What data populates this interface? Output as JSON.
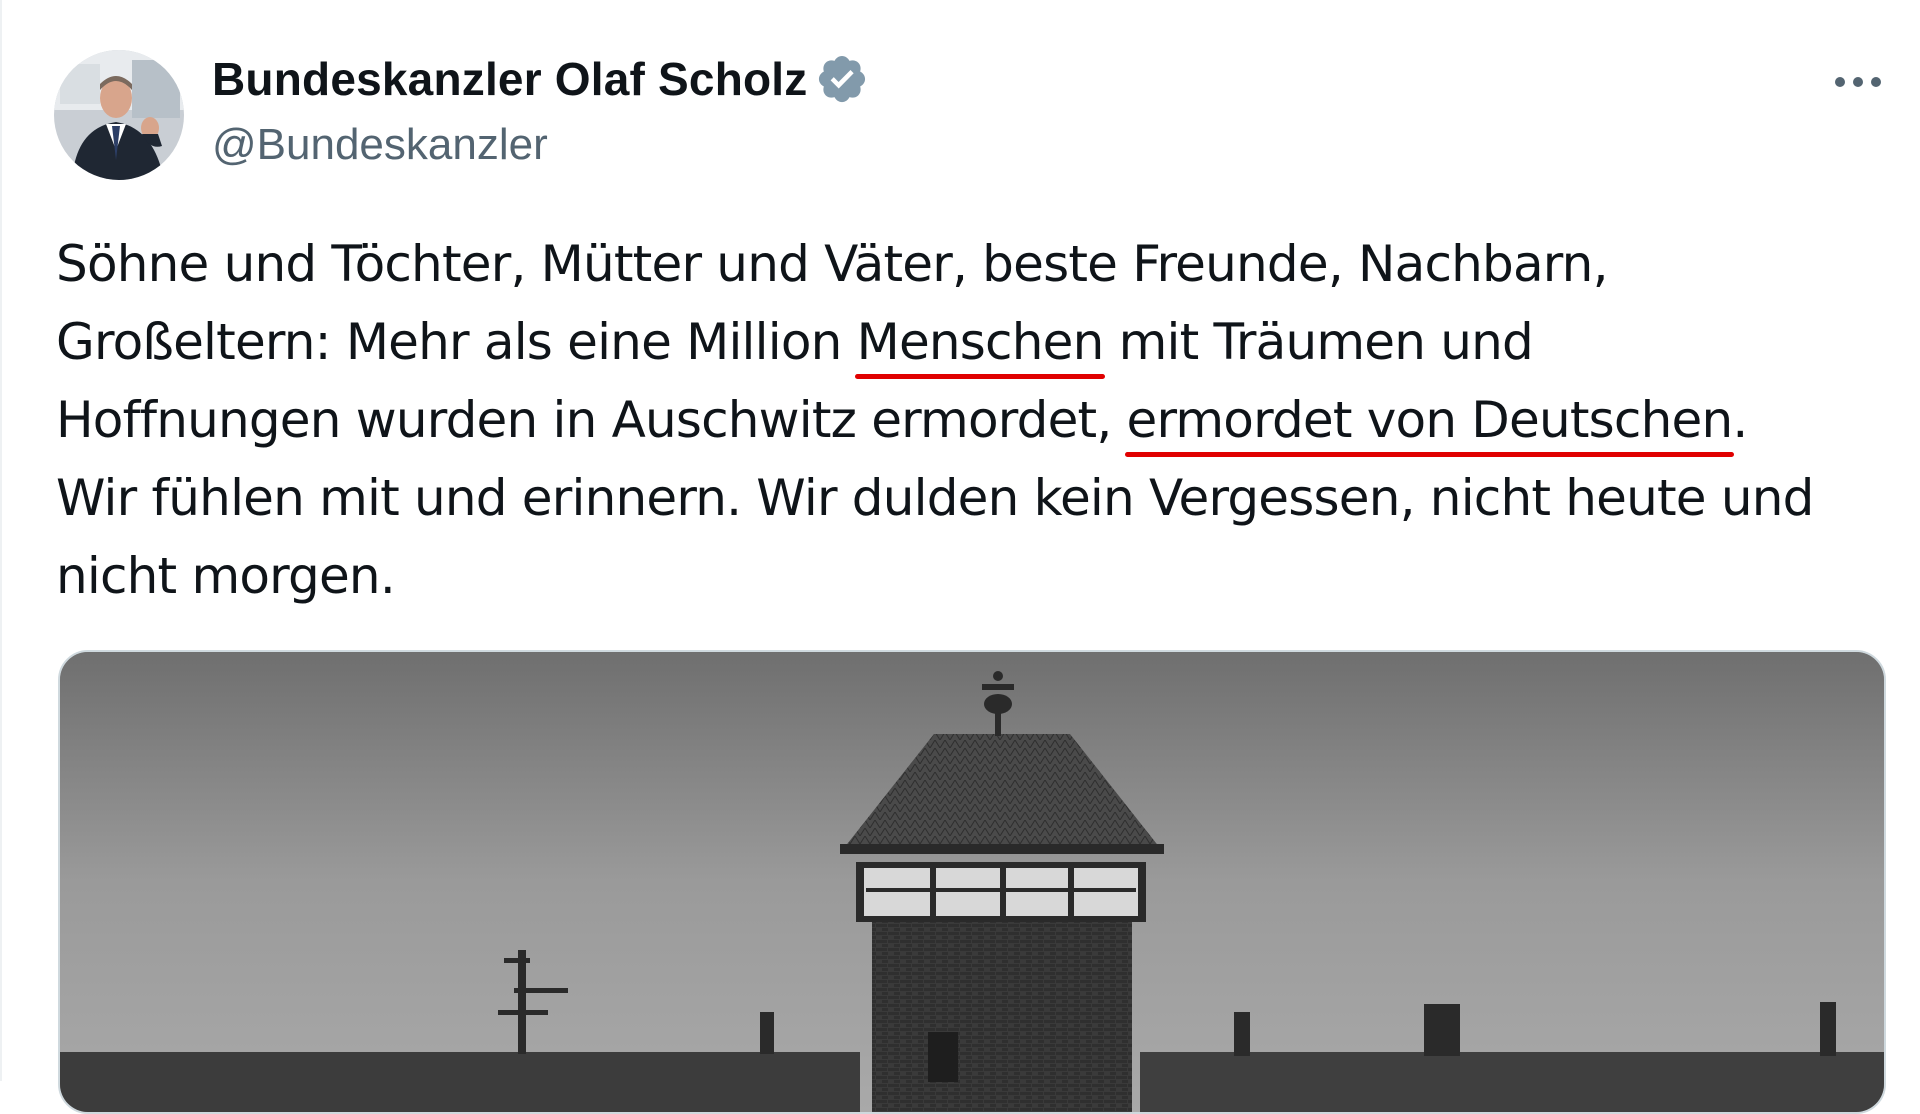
{
  "author": {
    "display_name": "Bundeskanzler Olaf Scholz",
    "handle": "@Bundeskanzler",
    "verified": true,
    "avatar_icon": "profile-photo",
    "verified_icon": "verified-badge-icon",
    "verified_color": "#829aab"
  },
  "menu": {
    "more_icon": "more-horizontal-icon",
    "label": "•••"
  },
  "tweet": {
    "lines": [
      [
        "Söhne und Töchter, Mütter und Väter, beste Freunde, Nachbarn,"
      ],
      [
        "Großeltern: Mehr als eine Million ",
        "Menschen",
        " mit Träumen und"
      ],
      [
        "Hoffnungen wurden in Auschwitz ermordet, ",
        "ermordet von Deutschen",
        "."
      ],
      [
        "Wir fühlen mit und erinnern. Wir dulden kein Vergessen, nicht heute und"
      ],
      [
        "nicht morgen."
      ]
    ],
    "underline_color": "#e00000"
  },
  "media": {
    "type": "photo",
    "description_icon": "black-and-white-photo"
  }
}
